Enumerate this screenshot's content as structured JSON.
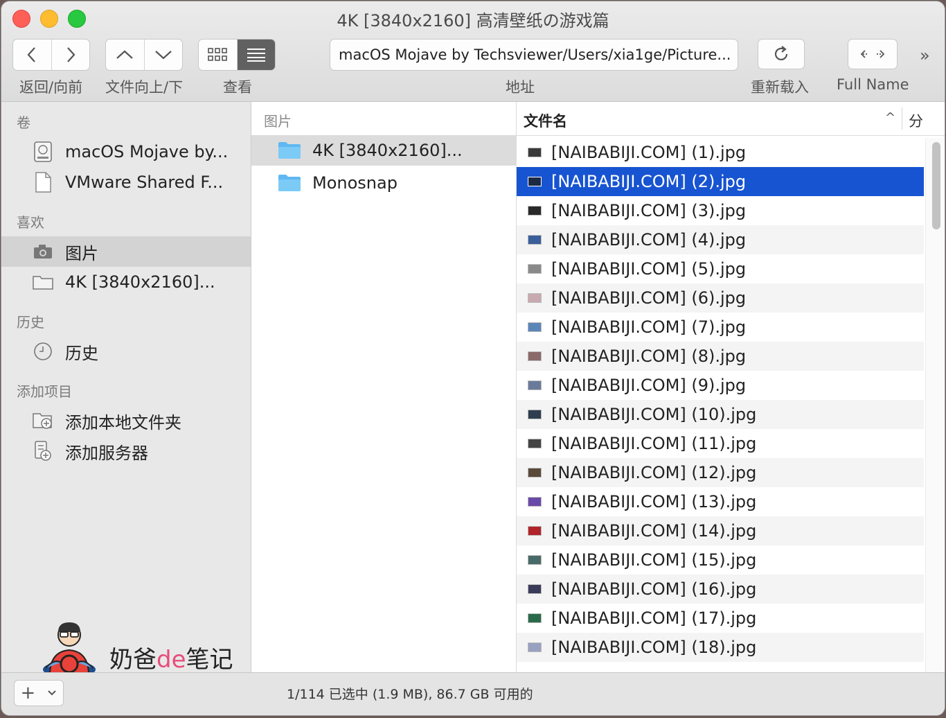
{
  "window": {
    "title": "4K [3840x2160] 高清壁纸の游戏篇"
  },
  "toolbar": {
    "nav_label": "返回/向前",
    "updown_label": "文件向上/下",
    "view_label": "查看",
    "address_label": "地址",
    "address_value": "macOS Mojave by Techsviewer/Users/xia1ge/Picture...",
    "reload_label": "重新载入",
    "fullname_label": "Full Name",
    "more": "»"
  },
  "sidebar": {
    "volumes_header": "卷",
    "volumes": [
      {
        "label": "macOS Mojave by..."
      },
      {
        "label": "VMware Shared F..."
      }
    ],
    "favorites_header": "喜欢",
    "favorites": [
      {
        "label": "图片",
        "selected": true
      },
      {
        "label": "4K [3840x2160]..."
      }
    ],
    "history_header": "历史",
    "history": [
      {
        "label": "历史"
      }
    ],
    "add_header": "添加项目",
    "add_items": [
      {
        "label": "添加本地文件夹"
      },
      {
        "label": "添加服务器"
      }
    ]
  },
  "middle": {
    "header": "图片",
    "items": [
      {
        "label": "4K [3840x2160]...",
        "selected": true
      },
      {
        "label": "Monosnap"
      }
    ]
  },
  "filelist": {
    "col_name": "文件名",
    "col2": "分",
    "sort_indicator": "^",
    "selected_index": 1,
    "files": [
      {
        "name": "[NAIBABIJI.COM] (1).jpg"
      },
      {
        "name": "[NAIBABIJI.COM] (2).jpg"
      },
      {
        "name": "[NAIBABIJI.COM] (3).jpg"
      },
      {
        "name": "[NAIBABIJI.COM] (4).jpg"
      },
      {
        "name": "[NAIBABIJI.COM] (5).jpg"
      },
      {
        "name": "[NAIBABIJI.COM] (6).jpg"
      },
      {
        "name": "[NAIBABIJI.COM] (7).jpg"
      },
      {
        "name": "[NAIBABIJI.COM] (8).jpg"
      },
      {
        "name": "[NAIBABIJI.COM] (9).jpg"
      },
      {
        "name": "[NAIBABIJI.COM] (10).jpg"
      },
      {
        "name": "[NAIBABIJI.COM] (11).jpg"
      },
      {
        "name": "[NAIBABIJI.COM] (12).jpg"
      },
      {
        "name": "[NAIBABIJI.COM] (13).jpg"
      },
      {
        "name": "[NAIBABIJI.COM] (14).jpg"
      },
      {
        "name": "[NAIBABIJI.COM] (15).jpg"
      },
      {
        "name": "[NAIBABIJI.COM] (16).jpg"
      },
      {
        "name": "[NAIBABIJI.COM] (17).jpg"
      },
      {
        "name": "[NAIBABIJI.COM] (18).jpg"
      }
    ],
    "thumb_colors": [
      "#3a3a3a",
      "#1c2a44",
      "#2a2a2a",
      "#3a5f9a",
      "#8a8a8a",
      "#c9a9b0",
      "#5a86b8",
      "#8a6a6a",
      "#6a7a9a",
      "#2f3f4f",
      "#444444",
      "#5a4a3a",
      "#6a4aa8",
      "#b0242a",
      "#4a6a6a",
      "#3a3a5a",
      "#2a6a4a",
      "#9aa0c0"
    ],
    "selection_color": "#1754d1"
  },
  "statusbar": {
    "add_glyph": "+",
    "text": "1/114 已选中 (1.9 MB), 86.7 GB 可用的"
  },
  "watermark": {
    "prefix": "奶爸",
    "mid": "de",
    "suffix": "笔记"
  }
}
